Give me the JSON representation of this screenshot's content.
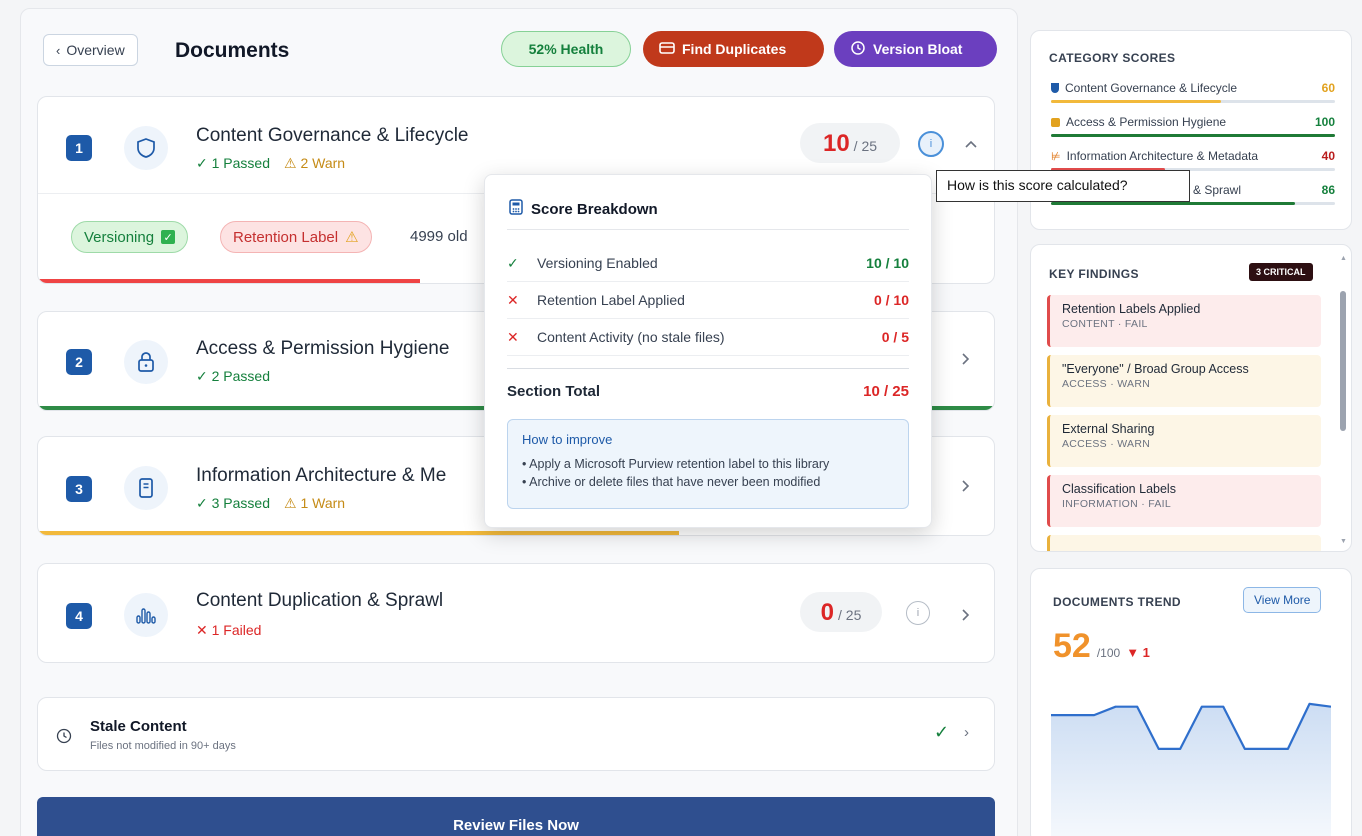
{
  "header": {
    "back_label": "Overview",
    "title": "Documents",
    "health_label": "52% Health",
    "duplicates_label": "Find Duplicates",
    "bloat_label": "Version Bloat"
  },
  "sections": [
    {
      "number": "1",
      "title": "Content Governance & Lifecycle",
      "passed": "1 Passed",
      "warn": "2 Warn",
      "score": "10",
      "max": "/ 25",
      "bar_fraction": 0.4,
      "bar_color": "#ef4444",
      "tags": {
        "versioning": "Versioning",
        "retention": "Retention Label",
        "note": "4999 old"
      }
    },
    {
      "number": "2",
      "title": "Access & Permission Hygiene",
      "passed": "2 Passed",
      "bar_fraction": 1.0,
      "bar_color": "#2e8b46"
    },
    {
      "number": "3",
      "title": "Information Architecture & Me",
      "passed": "3 Passed",
      "warn": "1 Warn",
      "bar_fraction": 0.67,
      "bar_color": "#f2b93b"
    },
    {
      "number": "4",
      "title": "Content Duplication & Sprawl",
      "failed": "1 Failed",
      "score": "0",
      "max": "/ 25"
    }
  ],
  "stale": {
    "title": "Stale Content",
    "subtitle": "Files not modified in 90+ days"
  },
  "review_label": "Review Files Now",
  "popover": {
    "title": "Score Breakdown",
    "rows": [
      {
        "label": "Versioning Enabled",
        "value": "10 / 10",
        "status": "pass"
      },
      {
        "label": "Retention Label Applied",
        "value": "0 / 10",
        "status": "fail"
      },
      {
        "label": "Content Activity (no stale files)",
        "value": "0 / 5",
        "status": "fail"
      }
    ],
    "total_label": "Section Total",
    "total_value": "10 / 25",
    "improve_title": "How to improve",
    "improve_items": [
      "Apply a Microsoft Purview retention label to this library",
      "Archive or delete files that have never been modified"
    ]
  },
  "tooltip": "How is this score calculated?",
  "category_scores": {
    "title": "CATEGORY SCORES",
    "items": [
      {
        "name": "Content Governance & Lifecycle",
        "value": "60",
        "fraction": 0.6,
        "color": "#f2b93b",
        "value_color": "#e2a21e"
      },
      {
        "name": "Access & Permission Hygiene",
        "value": "100",
        "fraction": 1.0,
        "color": "#1f7a36",
        "value_color": "#15803d"
      },
      {
        "name": "Information Architecture & Metadata",
        "value": "40",
        "fraction": 0.4,
        "color": "#e04b4b",
        "value_color": "#b91c1c"
      },
      {
        "name": "& Sprawl",
        "value": "86",
        "fraction": 0.86,
        "color": "#1f7a36",
        "value_color": "#15803d"
      }
    ]
  },
  "key_findings": {
    "title": "KEY FINDINGS",
    "badge": "3 CRITICAL",
    "items": [
      {
        "title": "Retention Labels Applied",
        "sub": "CONTENT · FAIL",
        "status": "fail"
      },
      {
        "title": "\"Everyone\" / Broad Group Access",
        "sub": "ACCESS · WARN",
        "status": "warn"
      },
      {
        "title": "External Sharing",
        "sub": "ACCESS · WARN",
        "status": "warn"
      },
      {
        "title": "Classification Labels",
        "sub": "INFORMATION · FAIL",
        "status": "fail"
      }
    ]
  },
  "trend": {
    "title": "DOCUMENTS TREND",
    "view_more": "View More",
    "score": "52",
    "max": "/100",
    "delta": "▼ 1",
    "values": [
      52,
      52,
      52,
      55,
      55,
      40,
      40,
      55,
      55,
      40,
      40,
      40,
      56,
      55
    ]
  }
}
